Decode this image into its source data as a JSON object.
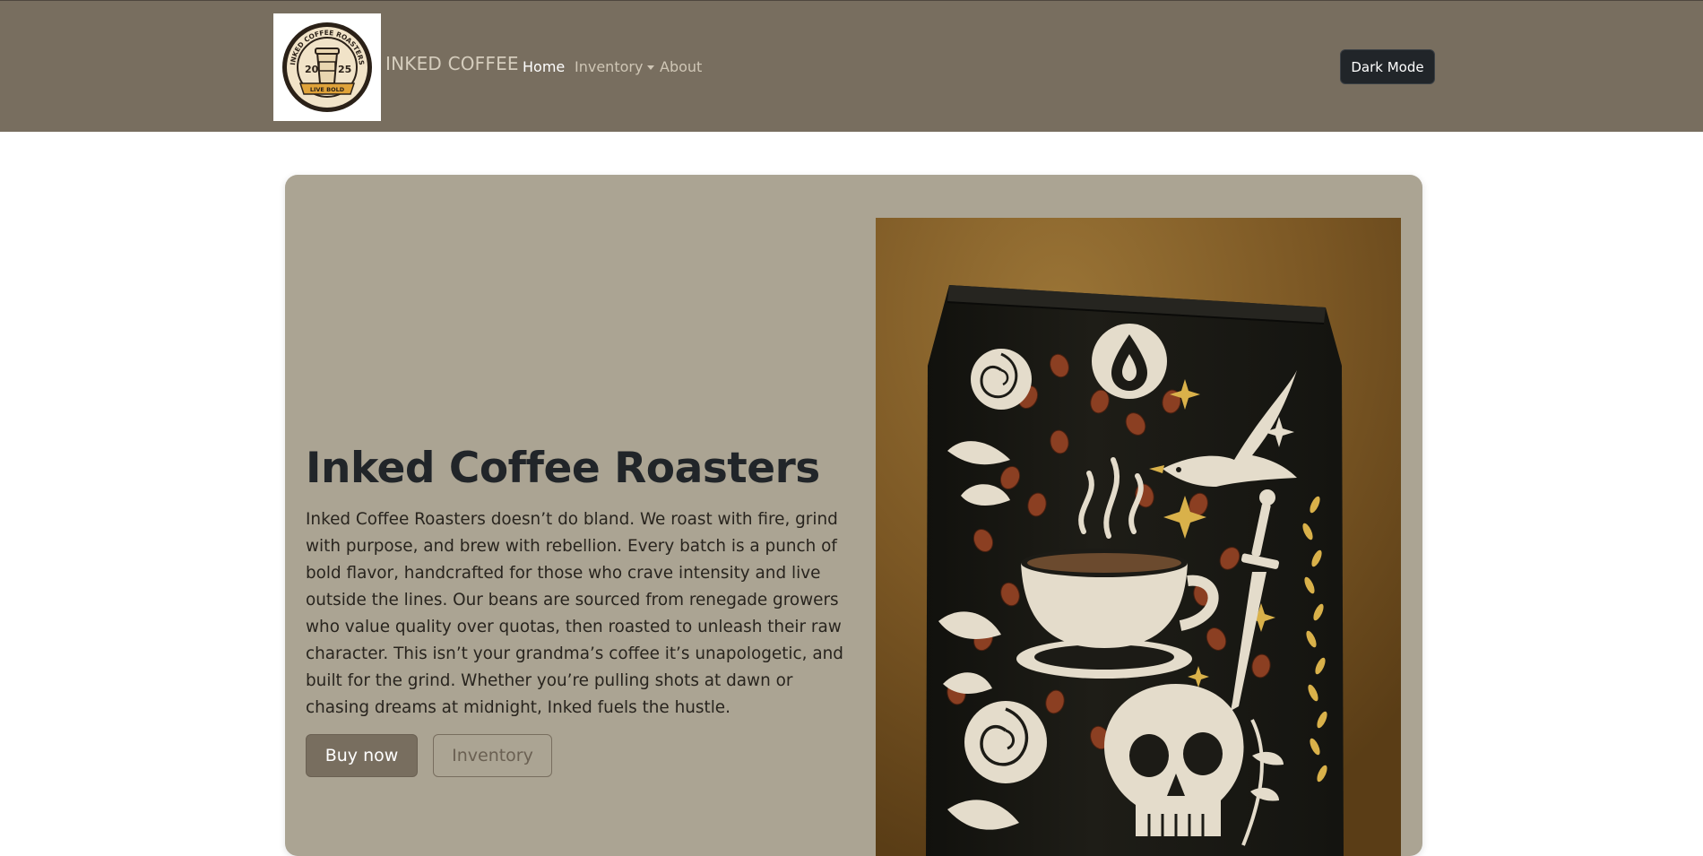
{
  "navbar": {
    "logo": {
      "text_top": "INKED COFFEE ROASTERS",
      "year_left": "20",
      "year_right": "25",
      "ribbon": "LIVE BOLD"
    },
    "brand": "INKED COFFEE",
    "links": [
      {
        "label": "Home",
        "active": true
      },
      {
        "label": "Inventory",
        "dropdown": true
      },
      {
        "label": "About"
      }
    ],
    "dark_mode_label": "Dark Mode"
  },
  "hero": {
    "title": "Inked Coffee Roasters",
    "description": "Inked Coffee Roasters doesn’t do bland. We roast with fire, grind with purpose, and brew with rebellion. Every batch is a punch of bold flavor, handcrafted for those who crave intensity and live outside the lines. Our beans are sourced from renegade growers who value quality over quotas, then roasted to unleash their raw character. This isn’t your grandma’s coffee it’s unapologetic, and built for the grind. Whether you’re pulling shots at dawn or chasing dreams at midnight, Inked fuels the hustle.",
    "buy_label": "Buy now",
    "inventory_label": "Inventory"
  },
  "colors": {
    "navbar_bg": "#786e5f",
    "hero_bg": "#aba493",
    "bag_bg": "#1c1b16",
    "backdrop": "#8a6630",
    "cream": "#e4dccb",
    "bean": "#8b3f22",
    "gold": "#d9b14a"
  }
}
